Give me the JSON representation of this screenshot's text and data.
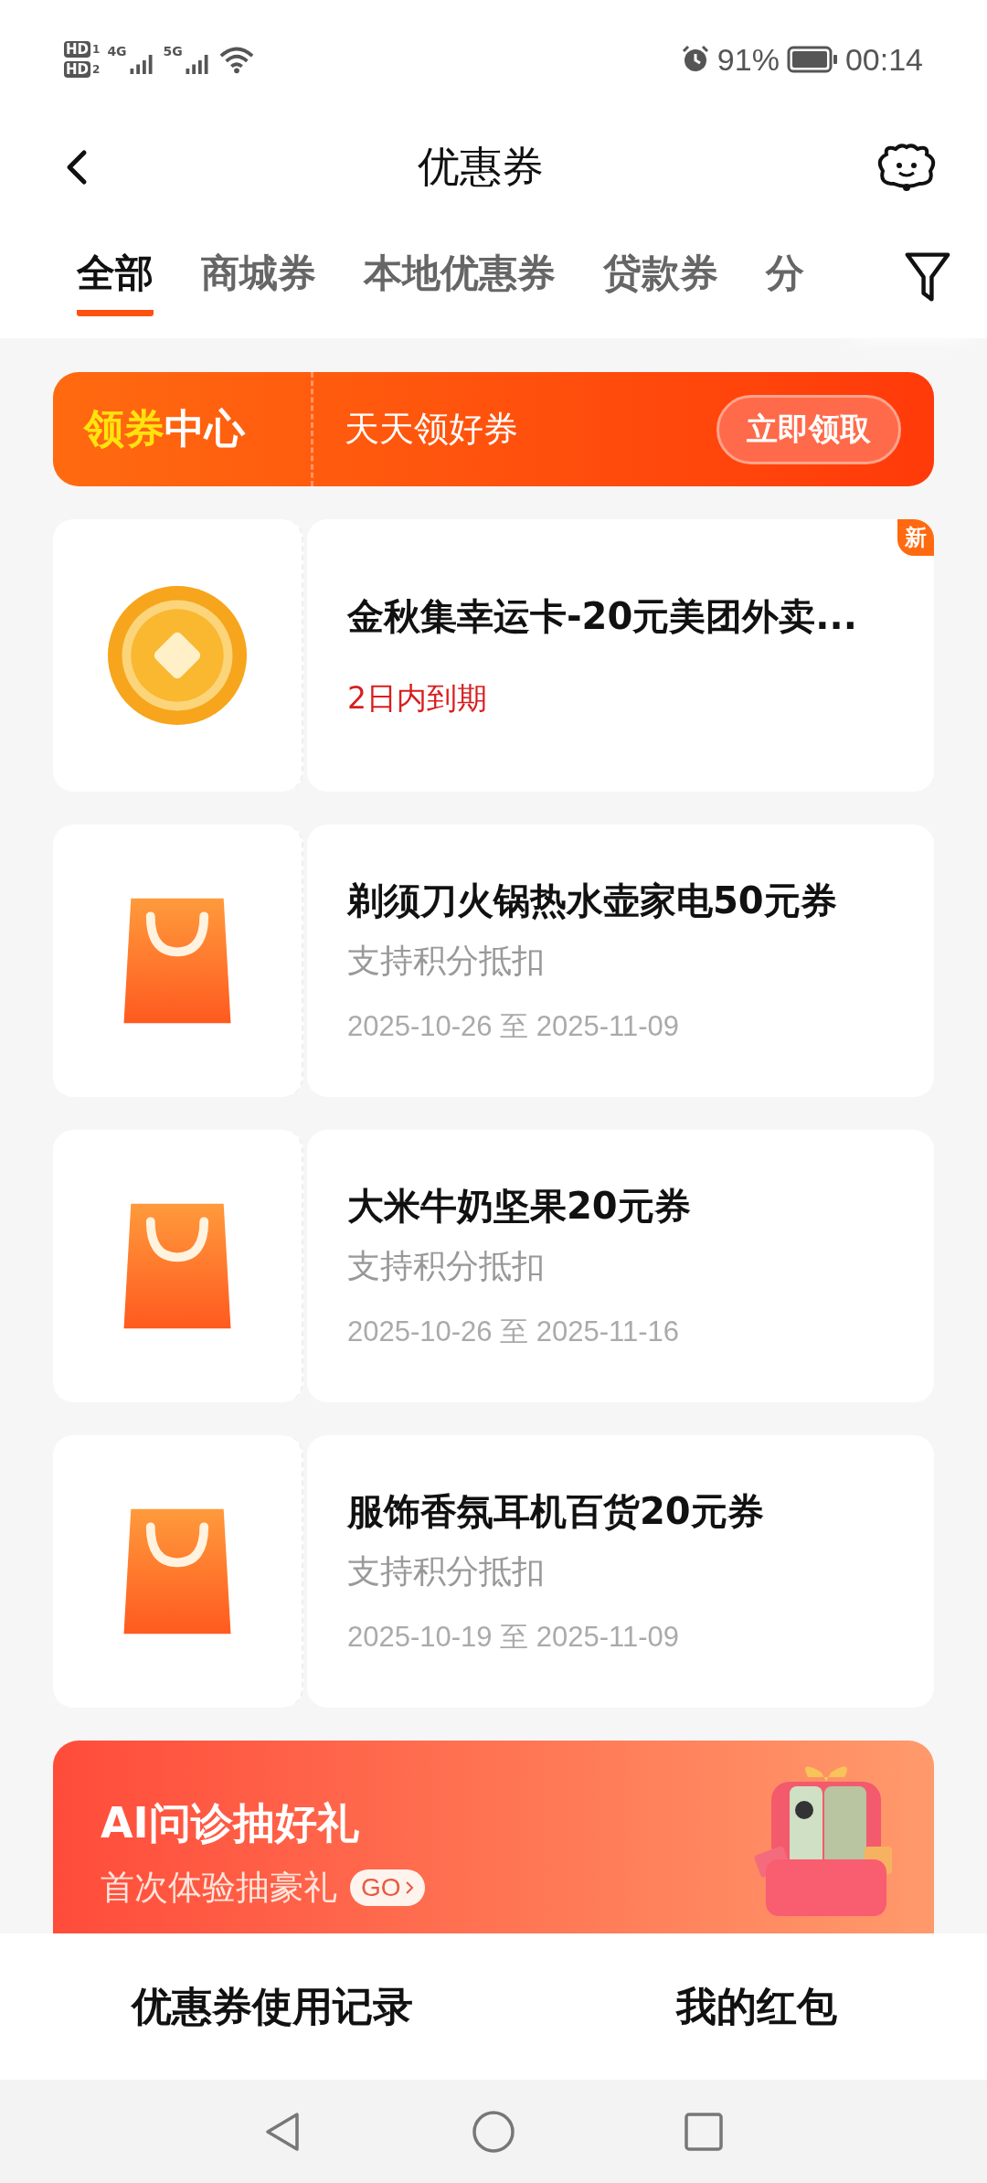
{
  "status_bar": {
    "sims": [
      {
        "hd": "HD",
        "slot": "1",
        "network": "4G"
      },
      {
        "hd": "HD",
        "slot": "2",
        "network": "5G"
      }
    ],
    "battery": "91%",
    "time": "00:14"
  },
  "header": {
    "title": "优惠券"
  },
  "tabs": [
    {
      "label": "全部",
      "selected": true
    },
    {
      "label": "商城券",
      "selected": false
    },
    {
      "label": "本地优惠券",
      "selected": false
    },
    {
      "label": "贷款券",
      "selected": false
    },
    {
      "label": "分",
      "selected": false
    }
  ],
  "banner": {
    "logo_first": "领券",
    "logo_second": "中心",
    "subtitle": "天天领好券",
    "button": "立即领取"
  },
  "coupons": [
    {
      "kind": "coin",
      "title": "金秋集幸运卡-20元美团外卖...",
      "badge": "新",
      "lines": [
        {
          "kind": "warning",
          "text": "2日内到期"
        }
      ]
    },
    {
      "kind": "bag",
      "title": "剃须刀火锅热水壶家电50元券",
      "lines": [
        {
          "kind": "note",
          "text": "支持积分抵扣"
        },
        {
          "kind": "date",
          "text": "2025-10-26 至 2025-11-09"
        }
      ]
    },
    {
      "kind": "bag",
      "title": "大米牛奶坚果20元券",
      "lines": [
        {
          "kind": "note",
          "text": "支持积分抵扣"
        },
        {
          "kind": "date",
          "text": "2025-10-26 至 2025-11-16"
        }
      ]
    },
    {
      "kind": "bag",
      "title": "服饰香氛耳机百货20元券",
      "lines": [
        {
          "kind": "note",
          "text": "支持积分抵扣"
        },
        {
          "kind": "date",
          "text": "2025-10-19 至 2025-11-09"
        }
      ]
    }
  ],
  "promo": {
    "title": "AI问诊抽好礼",
    "subtitle": "首次体验抽豪礼",
    "go": "GO"
  },
  "bottom_links": [
    "优惠券使用记录",
    "我的红包"
  ]
}
